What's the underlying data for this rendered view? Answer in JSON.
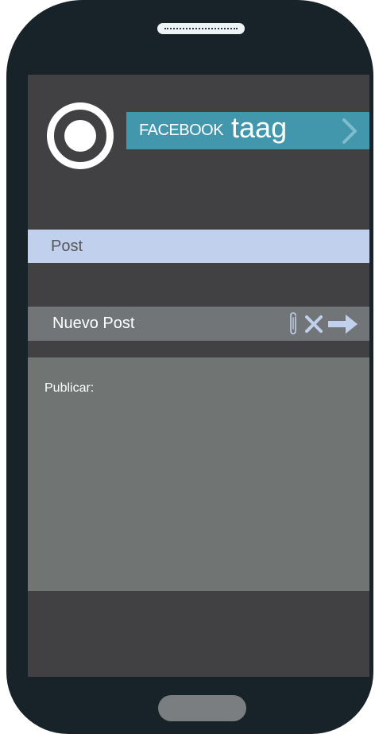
{
  "app": {
    "brand_prefix": "FACEBOOK",
    "brand_name": "taag"
  },
  "tabs": {
    "post_label": "Post"
  },
  "composer": {
    "title": "Nuevo Post",
    "publish_label": "Publicar:",
    "actions": [
      "paperclip-icon",
      "close-icon",
      "arrow-right-icon"
    ]
  },
  "colors": {
    "phone_body": "#182329",
    "screen_bg": "#414143",
    "brand_banner": "#4397ac",
    "post_bar": "#c1d0ec",
    "composer_bar": "#717577",
    "composer_area": "#707574",
    "icon_tint": "#c1d0ec"
  }
}
